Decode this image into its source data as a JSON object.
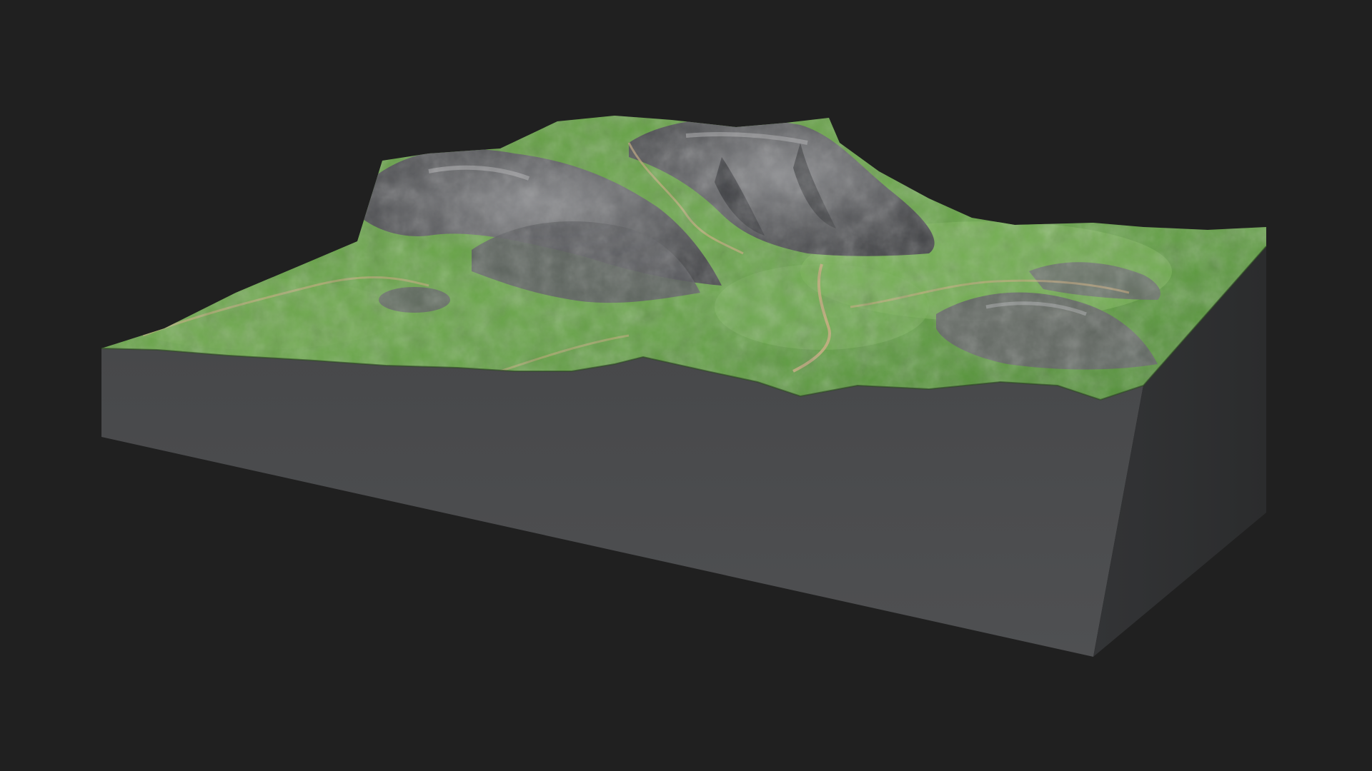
{
  "scene": {
    "background_color": "#202020",
    "side_front_color": "#4a4b4c",
    "side_right_color": "#303132",
    "grass_light": "#6fae4a",
    "grass_dark": "#3c7a2c",
    "rock_light": "#8b8c8e",
    "rock_dark": "#3f4043",
    "path_color": "#c8a97a"
  }
}
